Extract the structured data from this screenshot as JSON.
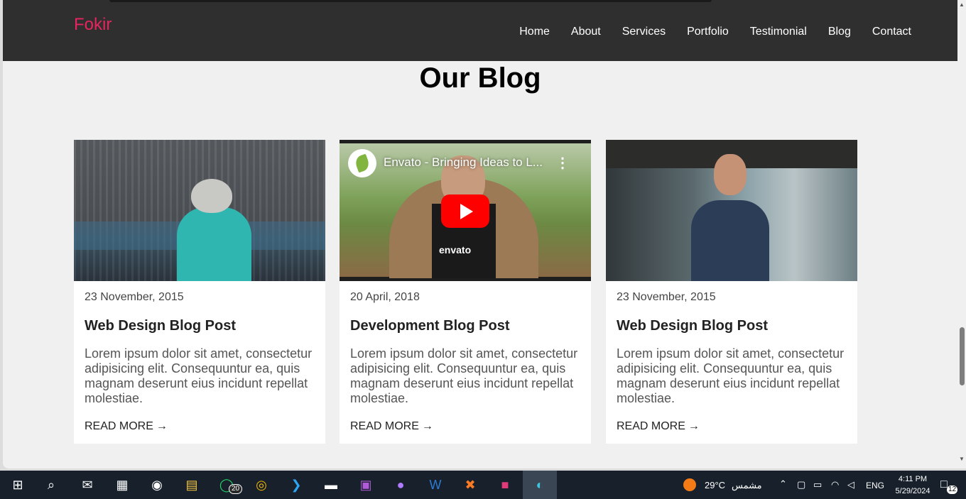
{
  "navbar": {
    "brand": "Fokir",
    "links": [
      "Home",
      "About",
      "Services",
      "Portfolio",
      "Testimonial",
      "Blog",
      "Contact"
    ]
  },
  "section": {
    "title": "Our Blog"
  },
  "cards": [
    {
      "date": "23 November, 2015",
      "title": "Web Design Blog Post",
      "text": "Lorem ipsum dolor sit amet, consectetur adipisicing elit. Consequuntur ea, quis magnam deserunt eius incidunt repellat molestiae.",
      "more": "READ MORE"
    },
    {
      "date": "20 April, 2018",
      "title": "Development Blog Post",
      "text": "Lorem ipsum dolor sit amet, consectetur adipisicing elit. Consequuntur ea, quis magnam deserunt eius incidunt repellat molestiae.",
      "more": "READ MORE",
      "video_title": "Envato - Bringing Ideas to L...",
      "video_brand": "envato"
    },
    {
      "date": "23 November, 2015",
      "title": "Web Design Blog Post",
      "text": "Lorem ipsum dolor sit amet, consectetur adipisicing elit. Consequuntur ea, quis magnam deserunt eius incidunt repellat molestiae.",
      "more": "READ MORE"
    }
  ],
  "colors": {
    "brand": "#e8245f",
    "navbar": "#2f2f2f",
    "page": "#f0f0f0",
    "youtube_red": "#ff0000"
  },
  "taskbar": {
    "icons": [
      "windows-start-icon",
      "search-icon",
      "mail-icon",
      "store-icon",
      "camera-icon",
      "file-explorer-icon",
      "whatsapp-icon",
      "chrome-icon",
      "vscode-icon",
      "terminal-icon",
      "pdf-icon",
      "github-icon",
      "word-icon",
      "xampp-icon",
      "intellij-icon",
      "edge-icon"
    ],
    "whatsapp_badge": "20",
    "weather_temp": "29°C",
    "weather_label": "مشمس",
    "language": "ENG",
    "time": "4:11 PM",
    "date": "5/29/2024",
    "notifications": "12"
  }
}
